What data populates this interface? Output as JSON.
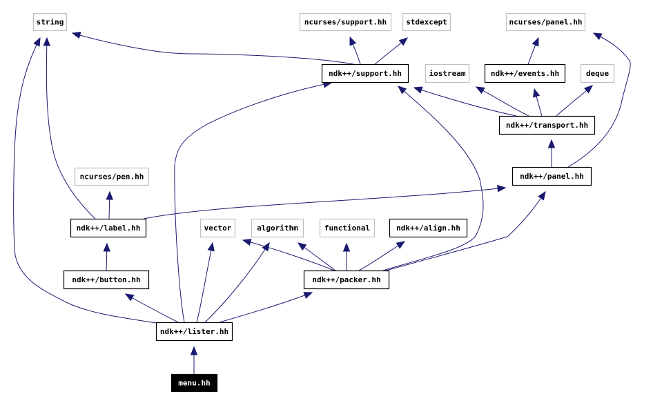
{
  "diagram": {
    "type": "include-dependency-graph",
    "colors": {
      "edge": "#191970",
      "node_border_project": "#000000",
      "node_border_external": "#bfbfbf",
      "node_fill": "#ffffff",
      "root_fill": "#000000",
      "root_text": "#ffffff",
      "text": "#000000"
    },
    "nodes": [
      {
        "id": "string",
        "label": "string",
        "kind": "external"
      },
      {
        "id": "ncurses_support",
        "label": "ncurses/support.hh",
        "kind": "external"
      },
      {
        "id": "stdexcept",
        "label": "stdexcept",
        "kind": "external"
      },
      {
        "id": "ncurses_panel",
        "label": "ncurses/panel.hh",
        "kind": "external"
      },
      {
        "id": "ndk_support",
        "label": "ndk++/support.hh",
        "kind": "project"
      },
      {
        "id": "iostream",
        "label": "iostream",
        "kind": "external"
      },
      {
        "id": "ndk_events",
        "label": "ndk++/events.hh",
        "kind": "project"
      },
      {
        "id": "deque",
        "label": "deque",
        "kind": "external"
      },
      {
        "id": "ndk_transport",
        "label": "ndk++/transport.hh",
        "kind": "project"
      },
      {
        "id": "ndk_panel",
        "label": "ndk++/panel.hh",
        "kind": "project"
      },
      {
        "id": "ncurses_pen",
        "label": "ncurses/pen.hh",
        "kind": "external"
      },
      {
        "id": "ndk_label",
        "label": "ndk++/label.hh",
        "kind": "project"
      },
      {
        "id": "vector",
        "label": "vector",
        "kind": "external"
      },
      {
        "id": "algorithm",
        "label": "algorithm",
        "kind": "external"
      },
      {
        "id": "functional",
        "label": "functional",
        "kind": "external"
      },
      {
        "id": "ndk_align",
        "label": "ndk++/align.hh",
        "kind": "project"
      },
      {
        "id": "ndk_button",
        "label": "ndk++/button.hh",
        "kind": "project"
      },
      {
        "id": "ndk_packer",
        "label": "ndk++/packer.hh",
        "kind": "project"
      },
      {
        "id": "ndk_lister",
        "label": "ndk++/lister.hh",
        "kind": "project"
      },
      {
        "id": "menu",
        "label": "menu.hh",
        "kind": "root"
      }
    ],
    "edges": [
      {
        "from": "ndk_support",
        "to": "string"
      },
      {
        "from": "ndk_support",
        "to": "ncurses_support"
      },
      {
        "from": "ndk_support",
        "to": "stdexcept"
      },
      {
        "from": "ndk_events",
        "to": "ncurses_panel"
      },
      {
        "from": "ndk_transport",
        "to": "ndk_support"
      },
      {
        "from": "ndk_transport",
        "to": "iostream"
      },
      {
        "from": "ndk_transport",
        "to": "ndk_events"
      },
      {
        "from": "ndk_transport",
        "to": "deque"
      },
      {
        "from": "ndk_panel",
        "to": "ndk_transport"
      },
      {
        "from": "ndk_panel",
        "to": "ncurses_panel"
      },
      {
        "from": "ndk_label",
        "to": "string"
      },
      {
        "from": "ndk_label",
        "to": "ncurses_pen"
      },
      {
        "from": "ndk_label",
        "to": "ndk_panel"
      },
      {
        "from": "ndk_button",
        "to": "ndk_label"
      },
      {
        "from": "ndk_packer",
        "to": "vector"
      },
      {
        "from": "ndk_packer",
        "to": "algorithm"
      },
      {
        "from": "ndk_packer",
        "to": "functional"
      },
      {
        "from": "ndk_packer",
        "to": "ndk_align"
      },
      {
        "from": "ndk_packer",
        "to": "ndk_support"
      },
      {
        "from": "ndk_packer",
        "to": "ndk_panel"
      },
      {
        "from": "ndk_lister",
        "to": "string"
      },
      {
        "from": "ndk_lister",
        "to": "ndk_support"
      },
      {
        "from": "ndk_lister",
        "to": "ndk_button"
      },
      {
        "from": "ndk_lister",
        "to": "vector"
      },
      {
        "from": "ndk_lister",
        "to": "algorithm"
      },
      {
        "from": "ndk_lister",
        "to": "ndk_packer"
      },
      {
        "from": "menu",
        "to": "ndk_lister"
      }
    ]
  }
}
